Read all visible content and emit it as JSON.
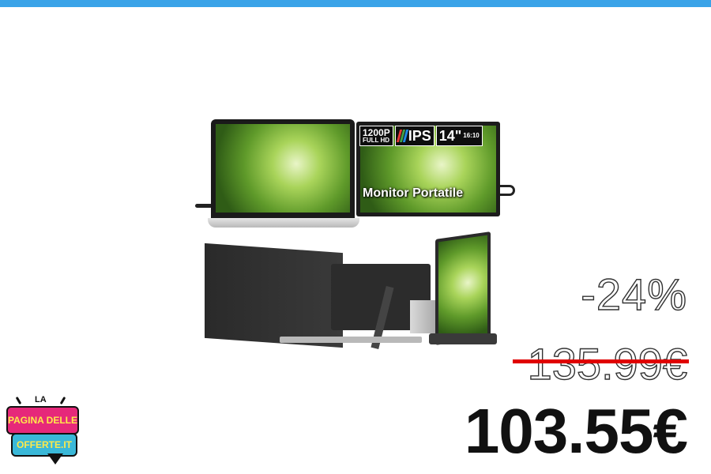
{
  "colors": {
    "top_bar": "#3aa3e8",
    "strike": "#e00000",
    "logo_pink": "#e6287a",
    "logo_blue": "#3ab8d8",
    "logo_yellow": "#ffe94a"
  },
  "product": {
    "specs": {
      "resolution": "1200P",
      "resolution_sub": "FULL HD",
      "panel": "IPS",
      "size": "14\"",
      "aspect": "16:10"
    },
    "monitor_label": "Monitor Portatile"
  },
  "pricing": {
    "discount": "-24%",
    "old_price": "135.99€",
    "new_price": "103.55€"
  },
  "logo": {
    "line1": "LA",
    "line2": "PAGINA DELLE",
    "line3": "OFFERTE.IT"
  }
}
